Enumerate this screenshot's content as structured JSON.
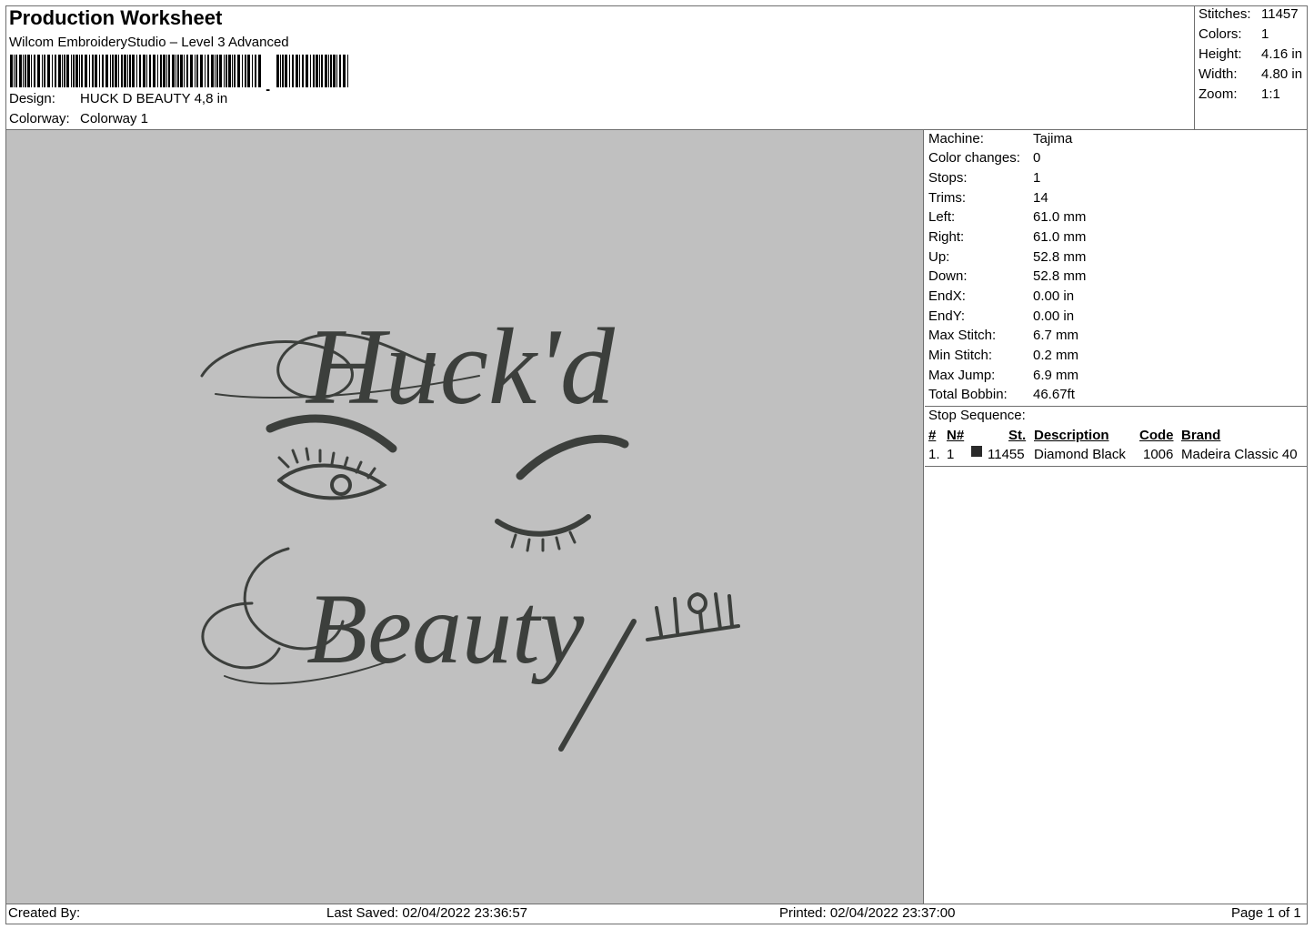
{
  "header": {
    "title": "Production Worksheet",
    "software": "Wilcom EmbroideryStudio – Level 3 Advanced",
    "design_label": "Design:",
    "design_value": "HUCK D BEAUTY 4,8 in",
    "colorway_label": "Colorway:",
    "colorway_value": "Colorway 1"
  },
  "stats": [
    {
      "label": "Stitches:",
      "value": "11457"
    },
    {
      "label": "Colors:",
      "value": "1"
    },
    {
      "label": "Height:",
      "value": "4.16 in"
    },
    {
      "label": "Width:",
      "value": "4.80 in"
    },
    {
      "label": "Zoom:",
      "value": "1:1"
    }
  ],
  "machine_info": [
    {
      "label": "Machine:",
      "value": "Tajima"
    },
    {
      "label": "Color changes:",
      "value": "0"
    },
    {
      "label": "Stops:",
      "value": "1"
    },
    {
      "label": "Trims:",
      "value": "14"
    },
    {
      "label": "Left:",
      "value": "61.0 mm"
    },
    {
      "label": "Right:",
      "value": "61.0 mm"
    },
    {
      "label": "Up:",
      "value": "52.8 mm"
    },
    {
      "label": "Down:",
      "value": "52.8 mm"
    },
    {
      "label": "EndX:",
      "value": "0.00 in"
    },
    {
      "label": "EndY:",
      "value": "0.00 in"
    },
    {
      "label": "Max Stitch:",
      "value": "6.7 mm"
    },
    {
      "label": "Min Stitch:",
      "value": "0.2 mm"
    },
    {
      "label": "Max Jump:",
      "value": "6.9 mm"
    },
    {
      "label": "Total Bobbin:",
      "value": "46.67ft"
    }
  ],
  "stop_sequence": {
    "title": "Stop Sequence:",
    "headers": {
      "num": "#",
      "n": "N#",
      "st": "St.",
      "description": "Description",
      "code": "Code",
      "brand": "Brand"
    },
    "rows": [
      {
        "num": "1.",
        "n": "1",
        "swatch_color": "#2a2a2a",
        "st": "11455",
        "description": "Diamond Black",
        "code": "1006",
        "brand": "Madeira Classic 40"
      }
    ]
  },
  "preview": {
    "background_color": "#c0c0c0",
    "thread_color": "#3c3f3c",
    "text_line_1": "Huck'd",
    "text_line_2": "Beauty"
  },
  "footer": {
    "created_by": "Created By:",
    "last_saved": "Last Saved: 02/04/2022 23:36:57",
    "printed": "Printed: 02/04/2022 23:37:00",
    "page": "Page 1 of 1"
  }
}
